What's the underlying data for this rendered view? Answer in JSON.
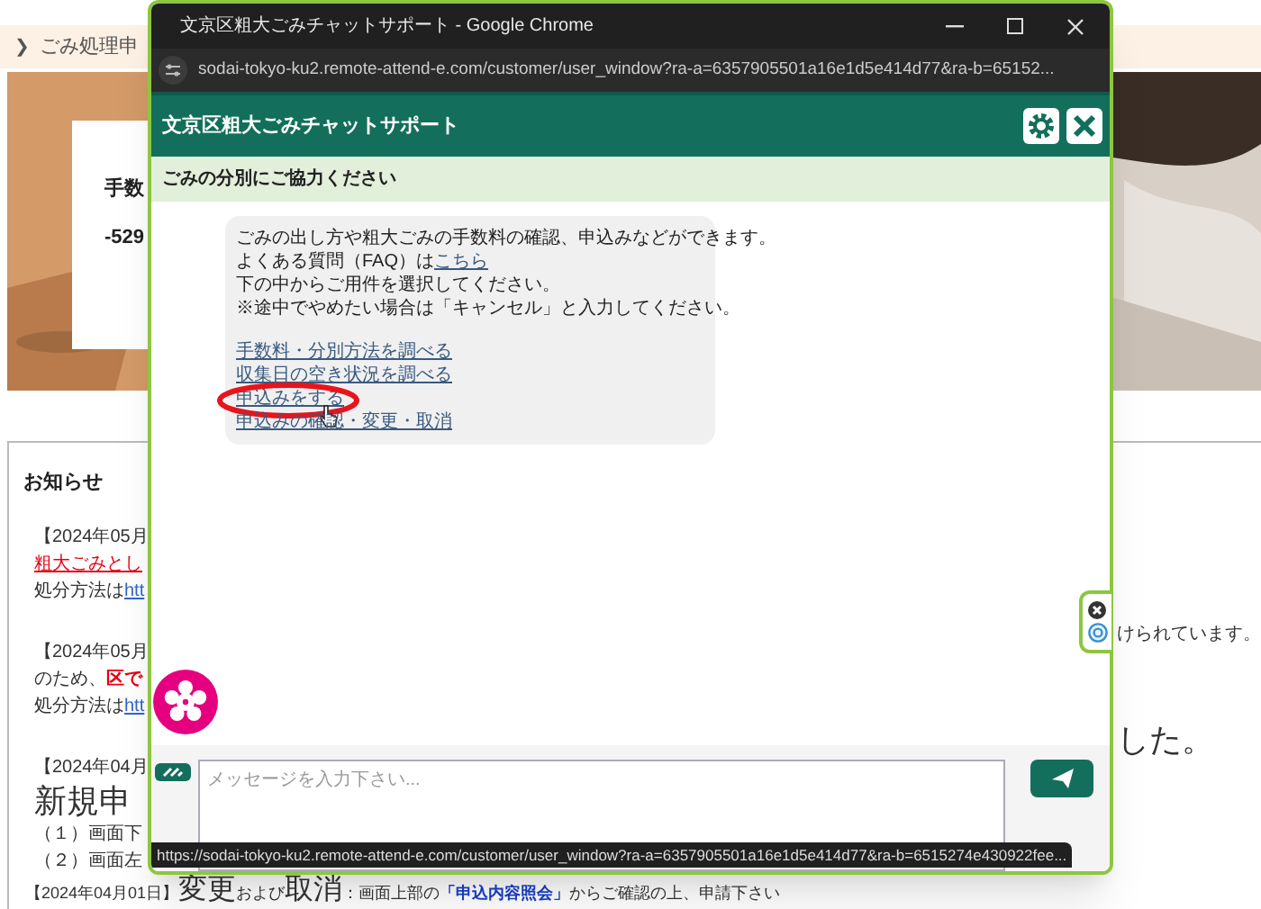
{
  "background_page": {
    "breadcrumb": {
      "chevron": "❯",
      "text": "ごみ処理申"
    },
    "hero": {
      "kind": "picture",
      "card_lines": [
        "手数",
        "-529"
      ]
    },
    "notices_title": "お知らせ",
    "notice_blocks": [
      [
        {
          "kind": "text",
          "parts": [
            {
              "kind": "plain",
              "text": "【2024年05月"
            }
          ]
        },
        {
          "kind": "text",
          "parts": [
            {
              "kind": "red_link",
              "text": "粗大ごみとし"
            }
          ]
        },
        {
          "kind": "text",
          "parts": [
            {
              "kind": "plain",
              "text": "処分方法は"
            },
            {
              "kind": "link",
              "text": "htt"
            }
          ]
        }
      ],
      [
        {
          "kind": "text",
          "parts": [
            {
              "kind": "plain",
              "text": "【2024年05月"
            }
          ]
        },
        {
          "kind": "text",
          "parts": [
            {
              "kind": "plain",
              "text": "のため、"
            },
            {
              "kind": "red_bold",
              "text": "区で"
            }
          ]
        },
        {
          "kind": "text",
          "parts": [
            {
              "kind": "plain",
              "text": "処分方法は"
            },
            {
              "kind": "link",
              "text": "htt"
            }
          ]
        }
      ],
      [
        {
          "kind": "text",
          "parts": [
            {
              "kind": "plain",
              "text": "【2024年04月"
            }
          ]
        },
        {
          "kind": "heading",
          "parts": [
            {
              "kind": "plain",
              "text": "新規申"
            }
          ]
        },
        {
          "kind": "text",
          "parts": [
            {
              "kind": "plain",
              "text": "（１）画面下"
            }
          ]
        },
        {
          "kind": "text",
          "parts": [
            {
              "kind": "plain",
              "text": "（２）画面左"
            }
          ]
        }
      ]
    ],
    "right_fragments": [
      {
        "kind": "text",
        "text": "けられています。"
      },
      {
        "kind": "heading",
        "text": "した。"
      }
    ],
    "footer_notice": [
      {
        "kind": "small",
        "text": "【2024年04月01日】"
      },
      {
        "kind": "large",
        "text": "変更"
      },
      {
        "kind": "small",
        "text": "および"
      },
      {
        "kind": "large",
        "text": "取消"
      },
      {
        "kind": "small",
        "text": "：画面上部の"
      },
      {
        "kind": "link_bold",
        "text": "「申込内容照会」"
      },
      {
        "kind": "small",
        "text": "からご確認の上、申請下さい"
      }
    ]
  },
  "chat_window": {
    "title": "文京区粗大ごみチャットサポート - Google Chrome",
    "url": "sodai-tokyo-ku2.remote-attend-e.com/customer/user_window?ra-a=6357905501a16e1d5e414d77&ra-b=65152...",
    "header_title": "文京区粗大ごみチャットサポート",
    "subheader": "ごみの分別にご協力ください",
    "message": [
      {
        "parts": [
          {
            "kind": "plain",
            "text": "ごみの出し方や粗大ごみの手数料の確認、申込みなどができます。"
          }
        ]
      },
      {
        "parts": [
          {
            "kind": "plain",
            "text": "よくある質問（FAQ）は"
          },
          {
            "kind": "link",
            "text": "こちら"
          }
        ]
      },
      {
        "parts": [
          {
            "kind": "plain",
            "text": "下の中からご用件を選択してください。"
          }
        ]
      },
      {
        "parts": [
          {
            "kind": "plain",
            "text": "※途中でやめたい場合は「キャンセル」と入力してください。"
          }
        ]
      }
    ],
    "options": [
      {
        "label": "手数料・分別方法を調べる",
        "circled": false
      },
      {
        "label": "収集日の空き状況を調べる",
        "circled": false
      },
      {
        "label": "申込みをする",
        "circled": true
      },
      {
        "label": "申込みの確認・変更・取消",
        "circled": false
      }
    ],
    "input": {
      "placeholder": "メッセージを入力下さい..."
    },
    "status_url": "https://sodai-tokyo-ku2.remote-attend-e.com/customer/user_window?ra-a=6357905501a16e1d5e414d77&ra-b=6515274e430922fee..."
  }
}
